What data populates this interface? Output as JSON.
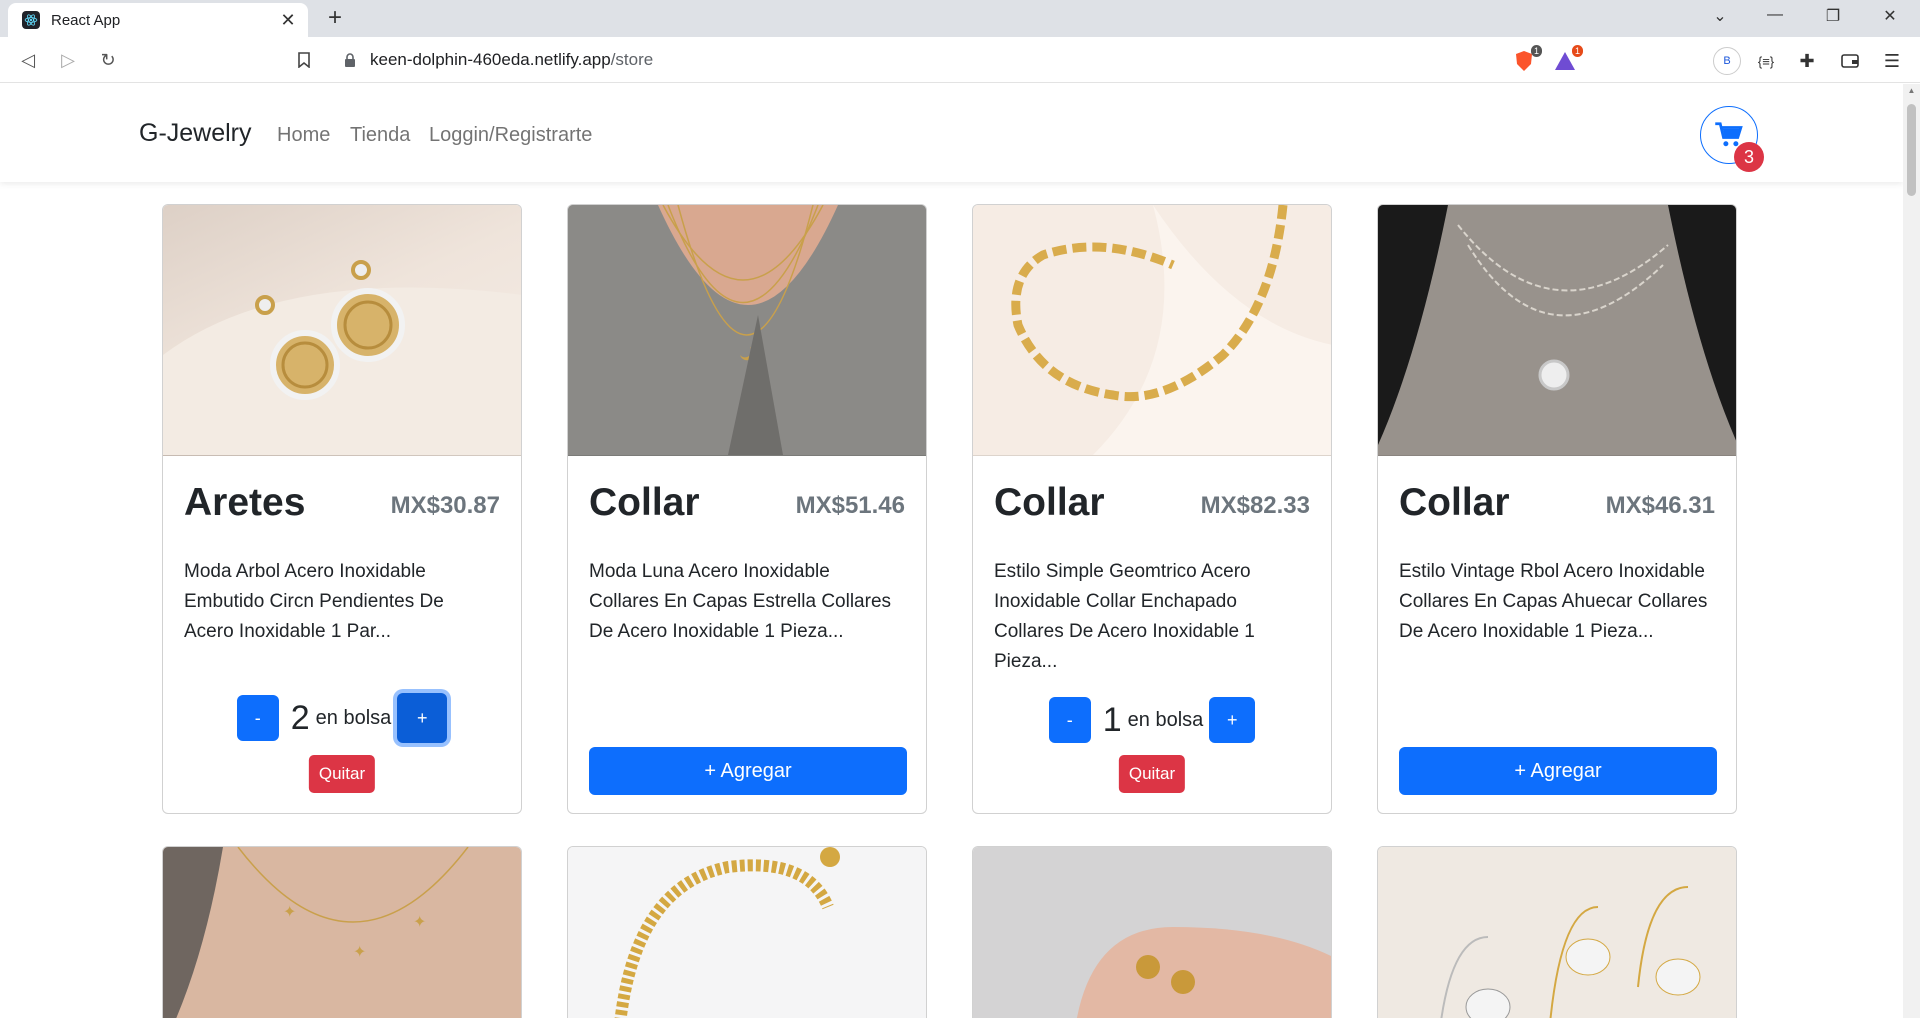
{
  "browser": {
    "tab_title": "React App",
    "url_host": "keen-dolphin-460eda.netlify.app",
    "url_path": "/store",
    "profile_initial": "B",
    "ext_badge_1": "1",
    "ext_badge_2": "1"
  },
  "navbar": {
    "brand": "G-Jewelry",
    "links": [
      "Home",
      "Tienda",
      "Loggin/Registrarte"
    ],
    "cart_count": "3"
  },
  "products": [
    {
      "name": "Aretes",
      "price": "MX$30.87",
      "description": "Moda Arbol Acero Inoxidable Embutido Circn Pendientes De Acero Inoxidable 1 Par...",
      "in_bag": true,
      "quantity": "2",
      "bag_label": "en bolsa",
      "minus_label": "-",
      "plus_label": "+",
      "remove_label": "Quitar"
    },
    {
      "name": "Collar",
      "price": "MX$51.46",
      "description": "Moda Luna Acero Inoxidable Collares En Capas Estrella Collares De Acero Inoxidable 1 Pieza...",
      "in_bag": false,
      "add_label": "+ Agregar"
    },
    {
      "name": "Collar",
      "price": "MX$82.33",
      "description": "Estilo Simple Geomtrico Acero Inoxidable Collar Enchapado Collares De Acero Inoxidable 1 Pieza...",
      "in_bag": true,
      "quantity": "1",
      "bag_label": "en bolsa",
      "minus_label": "-",
      "plus_label": "+",
      "remove_label": "Quitar"
    },
    {
      "name": "Collar",
      "price": "MX$46.31",
      "description": "Estilo Vintage Rbol Acero Inoxidable Collares En Capas Ahuecar Collares De Acero Inoxidable 1 Pieza...",
      "in_bag": false,
      "add_label": "+ Agregar"
    }
  ],
  "colors": {
    "primary": "#0d6efd",
    "danger": "#dc3545",
    "muted": "#6c757d"
  }
}
